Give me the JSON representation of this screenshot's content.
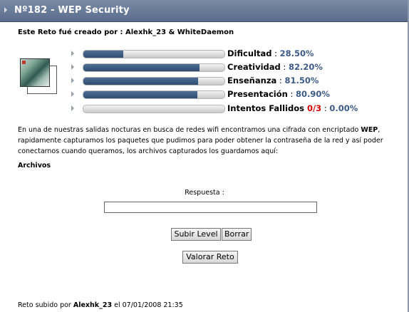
{
  "title": "Nº182 - WEP Security",
  "created_by": {
    "prefix": "Este Reto fué creado por : ",
    "authors": "Alexhk_23 & WhiteDaemon"
  },
  "stats": [
    {
      "name": "Dificultad",
      "value": "28.50%",
      "fraction": 0.285
    },
    {
      "name": "Creatividad",
      "value": "82.20%",
      "fraction": 0.822
    },
    {
      "name": "Enseñanza",
      "value": "81.50%",
      "fraction": 0.815
    },
    {
      "name": "Presentación",
      "value": "80.90%",
      "fraction": 0.809
    },
    {
      "name": "Intentos Fallidos",
      "fails": "0/3",
      "value": "0.00%",
      "fraction": 0.0
    }
  ],
  "description": {
    "part1": "En una de nuestras salidas nocturas en busca de redes wifi encontramos una cifrada con encriptado ",
    "bold": "WEP",
    "part2": ", rapidamente capturamos los paquetes que pudimos para poder obtener la contraseña de la red y así poder conectarnos cuando queramos, los archivos capturados los guardamos aquí:"
  },
  "files_label": "Archivos",
  "answer": {
    "label": "Respuesta :",
    "value": ""
  },
  "buttons": {
    "submit": "Subir Level",
    "clear": "Borrar",
    "rate": "Valorar Reto"
  },
  "footer": {
    "prefix": "Reto subido por ",
    "user": "Alexhk_23",
    "suffix": " el 07/01/2008 21:35"
  },
  "colors": {
    "bar_fill": "#3a5a80",
    "pct_text": "#3c5a87",
    "fails_text": "#d40000",
    "titlebar": "#6a7b98"
  }
}
